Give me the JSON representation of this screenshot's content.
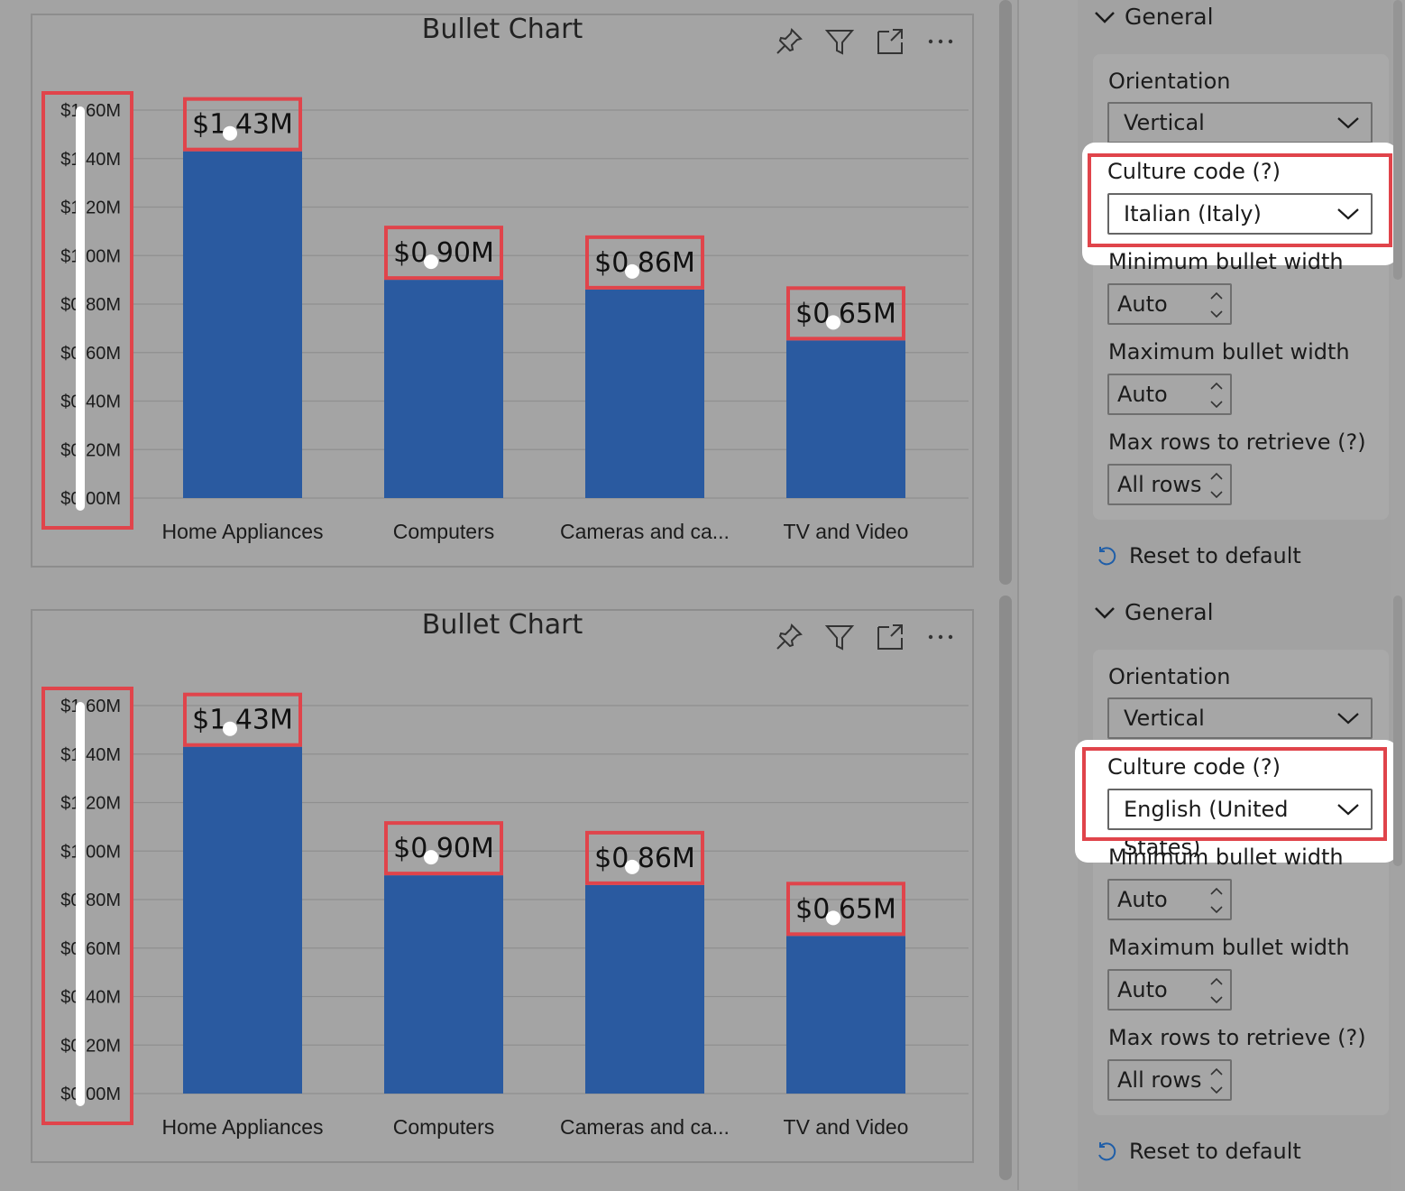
{
  "visuals": [
    {
      "title": "Bullet Chart",
      "icons": [
        "pin-icon",
        "filter-icon",
        "focus-mode-icon",
        "more-options-icon"
      ],
      "y_ticks": [
        "$0,00M",
        "$0,20M",
        "$0,40M",
        "$0,60M",
        "$0,80M",
        "$1,00M",
        "$1,20M",
        "$1,40M",
        "$1,60M"
      ],
      "data_labels": [
        "$1,43M",
        "$0,90M",
        "$0,86M",
        "$0,65M"
      ]
    },
    {
      "title": "Bullet Chart",
      "icons": [
        "pin-icon",
        "filter-icon",
        "focus-mode-icon",
        "more-options-icon"
      ],
      "y_ticks": [
        "$0.00M",
        "$0.20M",
        "$0.40M",
        "$0.60M",
        "$0.80M",
        "$1.00M",
        "$1.20M",
        "$1.40M",
        "$1.60M"
      ],
      "data_labels": [
        "$1.43M",
        "$0.90M",
        "$0.86M",
        "$0.65M"
      ]
    }
  ],
  "chart_data": [
    {
      "type": "bar",
      "title": "Bullet Chart",
      "categories": [
        "Home Appliances",
        "Computers",
        "Cameras and ca...",
        "TV and Video"
      ],
      "values": [
        1.43,
        0.9,
        0.86,
        0.65
      ],
      "ylim": [
        0,
        1.6
      ],
      "unit": "$M",
      "grid": true,
      "bar_color": "#2a5aa0",
      "culture": "Italian (Italy)"
    },
    {
      "type": "bar",
      "title": "Bullet Chart",
      "categories": [
        "Home Appliances",
        "Computers",
        "Cameras and ca...",
        "TV and Video"
      ],
      "values": [
        1.43,
        0.9,
        0.86,
        0.65
      ],
      "ylim": [
        0,
        1.6
      ],
      "unit": "$M",
      "grid": true,
      "bar_color": "#2a5aa0",
      "culture": "English (United States)"
    }
  ],
  "panes": [
    {
      "section_title": "General",
      "orientation_label": "Orientation",
      "orientation_value": "Vertical",
      "culture_label": "Culture code (?)",
      "culture_value": "Italian (Italy)",
      "min_width_label": "Minimum bullet width",
      "min_width_value": "Auto",
      "max_width_label": "Maximum bullet width",
      "max_width_value": "Auto",
      "max_rows_label": "Max rows to retrieve (?)",
      "max_rows_value": "All rows",
      "reset_label": "Reset to default"
    },
    {
      "section_title": "General",
      "orientation_label": "Orientation",
      "orientation_value": "Vertical",
      "culture_label": "Culture code (?)",
      "culture_value": "English (United States)",
      "min_width_label": "Minimum bullet width",
      "min_width_value": "Auto",
      "max_width_label": "Maximum bullet width",
      "max_width_value": "Auto",
      "max_rows_label": "Max rows to retrieve (?)",
      "max_rows_value": "All rows",
      "reset_label": "Reset to default"
    }
  ],
  "colors": {
    "highlight_red": "#e0444b",
    "bar_blue": "#2a5aa0",
    "background": "#a3a3a3"
  }
}
